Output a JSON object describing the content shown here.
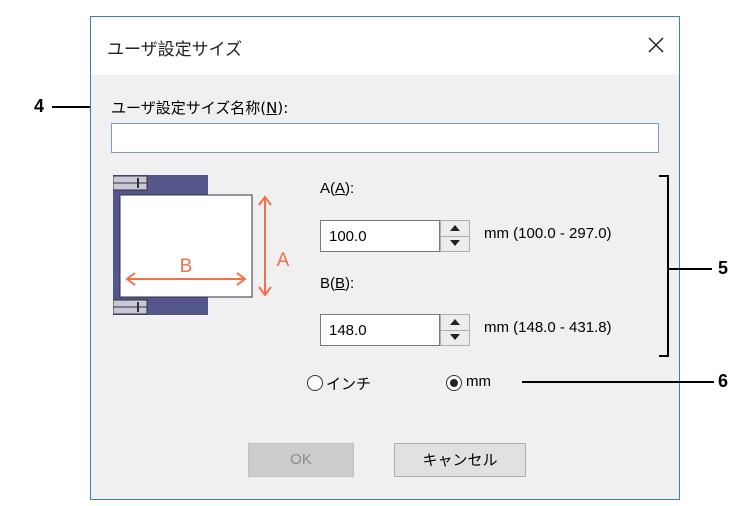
{
  "dialog": {
    "title": "ユーザ設定サイズ",
    "close_icon": "close-icon"
  },
  "name_field": {
    "label_prefix": "ユーザ設定サイズ名称(",
    "label_mnemonic": "N",
    "label_suffix": "):",
    "value": ""
  },
  "paper_diagram": {
    "label_a": "A",
    "label_b": "B",
    "accent_color": "#f0704a",
    "tray_color": "#55568a"
  },
  "field_a": {
    "label_prefix": "A(",
    "label_mnemonic": "A",
    "label_suffix": "):",
    "value": "100.0",
    "range": "mm (100.0 - 297.0)"
  },
  "field_b": {
    "label_prefix": "B(",
    "label_mnemonic": "B",
    "label_suffix": "):",
    "value": "148.0",
    "range": "mm (148.0 - 431.8)"
  },
  "units": {
    "inch_label": "インチ",
    "mm_label": "mm",
    "selected": "mm"
  },
  "buttons": {
    "ok_label": "OK",
    "cancel_label": "キャンセル"
  },
  "callouts": {
    "c4": "4",
    "c5": "5",
    "c6": "6"
  }
}
